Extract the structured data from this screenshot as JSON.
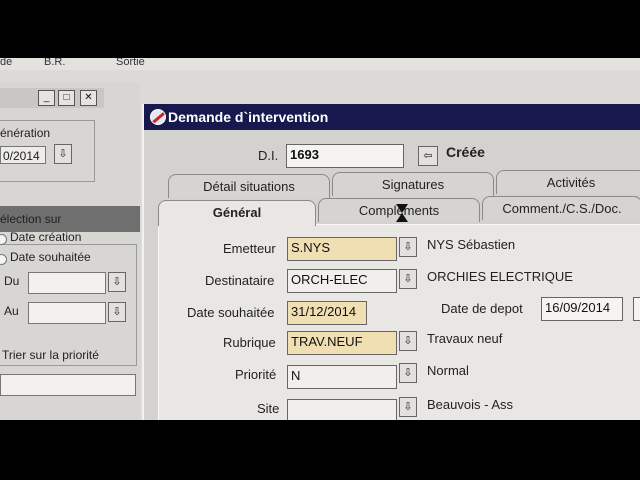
{
  "menu": {
    "items": [
      "de",
      "B.R.",
      "Sortie"
    ]
  },
  "left_window": {
    "controls": {
      "minimize": "_",
      "maximize": "□",
      "close": "✕"
    },
    "group1_label": "énération",
    "group1_value": "0/2014",
    "group2_label": "élection sur",
    "radio_options": [
      "Date création",
      "Date souhaitée"
    ],
    "du_label": "Du",
    "au_label": "Au",
    "sort_label": "Trier sur la priorité"
  },
  "dialog": {
    "title": "Demande d`intervention",
    "di_label": "D.I.",
    "di_value": "1693",
    "status": "Créée",
    "tabs_back": [
      "Détail situations",
      "Signatures",
      "Activités"
    ],
    "tabs_front": [
      "Général",
      "Compléments",
      "Comment./C.S./Doc."
    ],
    "form": {
      "emetteur_label": "Emetteur",
      "emetteur_value": "S.NYS",
      "emetteur_name": "NYS Sébastien",
      "destinataire_label": "Destinataire",
      "destinataire_value": "ORCH-ELEC",
      "destinataire_name": "ORCHIES ELECTRIQUE",
      "date_souhaitee_label": "Date souhaitée",
      "date_souhaitee_value": "31/12/2014",
      "date_depot_label": "Date de depot",
      "date_depot_value": "16/09/2014",
      "rubrique_label": "Rubrique",
      "rubrique_value": "TRAV.NEUF",
      "rubrique_name": "Travaux neuf",
      "priorite_label": "Priorité",
      "priorite_value": "N",
      "priorite_name": "Normal",
      "site_label": "Site",
      "site_name": "Beauvois - Ass"
    }
  }
}
